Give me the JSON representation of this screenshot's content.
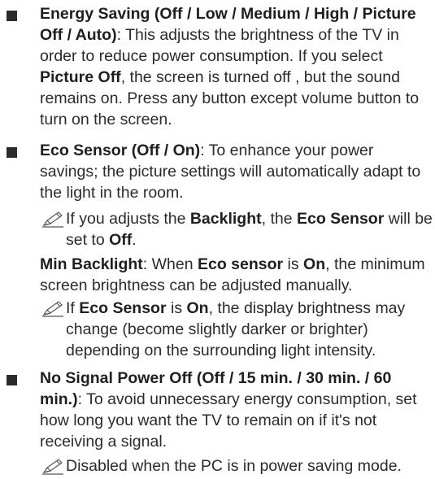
{
  "sections": {
    "energy": {
      "title": "Energy Saving (Off / Low / Medium / High / Picture Off / Auto)",
      "sep": ": ",
      "t1": "This adjusts the brightness of the TV in order to reduce power consumption. If you select ",
      "b1": "Picture Off",
      "t2": ", the screen is turned off , but the sound remains on. Press any button except volume button to turn on the screen."
    },
    "eco": {
      "title": "Eco Sensor (Off / On)",
      "sep": ": ",
      "t1": "To enhance your power savings; the picture settings will automatically adapt to the light in the room.",
      "note1": {
        "t1": "If you adjusts the ",
        "b1": "Backlight",
        "t2": ", the ",
        "b2": "Eco Sensor",
        "t3": " will be set to ",
        "b3": "Off",
        "t4": "."
      },
      "minbl": {
        "b1": "Min Backlight",
        "t1": ": When ",
        "b2": "Eco sensor",
        "t2": " is ",
        "b3": "On",
        "t3": ", the minimum screen brightness can be adjusted manually."
      },
      "note2": {
        "t1": "If ",
        "b1": "Eco Sensor",
        "t2": " is ",
        "b2": "On",
        "t3": ", the display brightness may change (become slightly darker or brighter) depending on the surrounding light intensity."
      }
    },
    "nosignal": {
      "title": "No Signal Power Off (Off / 15 min. / 30 min. / 60 min.)",
      "sep": ": ",
      "t1": "To avoid unnecessary energy consumption, set how long you want the TV to remain on if it's not receiving a signal.",
      "note": {
        "t1": "Disabled when the PC is in power saving mode."
      }
    }
  },
  "icons": {
    "bullet": "square-bullet-icon",
    "note": "pencil-note-icon"
  }
}
